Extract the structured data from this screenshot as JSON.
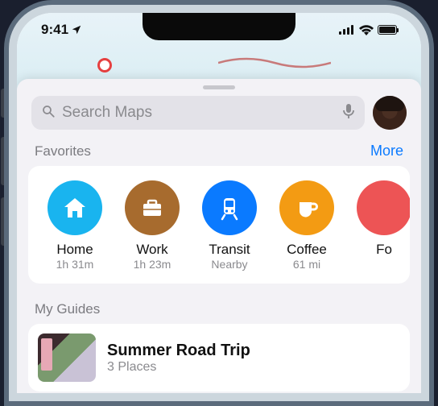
{
  "status": {
    "time": "9:41"
  },
  "search": {
    "placeholder": "Search Maps"
  },
  "sections": {
    "favorites": {
      "title": "Favorites",
      "more": "More"
    },
    "guides": {
      "title": "My Guides"
    }
  },
  "favorites": [
    {
      "label": "Home",
      "sub": "1h 31m",
      "color": "c-blue",
      "icon": "house"
    },
    {
      "label": "Work",
      "sub": "1h 23m",
      "color": "c-brown",
      "icon": "briefcase"
    },
    {
      "label": "Transit",
      "sub": "Nearby",
      "color": "c-blue2",
      "icon": "train"
    },
    {
      "label": "Coffee",
      "sub": "61 mi",
      "color": "c-orange",
      "icon": "cup"
    },
    {
      "label": "Fo",
      "sub": "",
      "color": "c-red",
      "icon": ""
    }
  ],
  "guides": [
    {
      "title": "Summer Road Trip",
      "sub": "3 Places"
    }
  ],
  "colors": {
    "link": "#0a7aff"
  }
}
